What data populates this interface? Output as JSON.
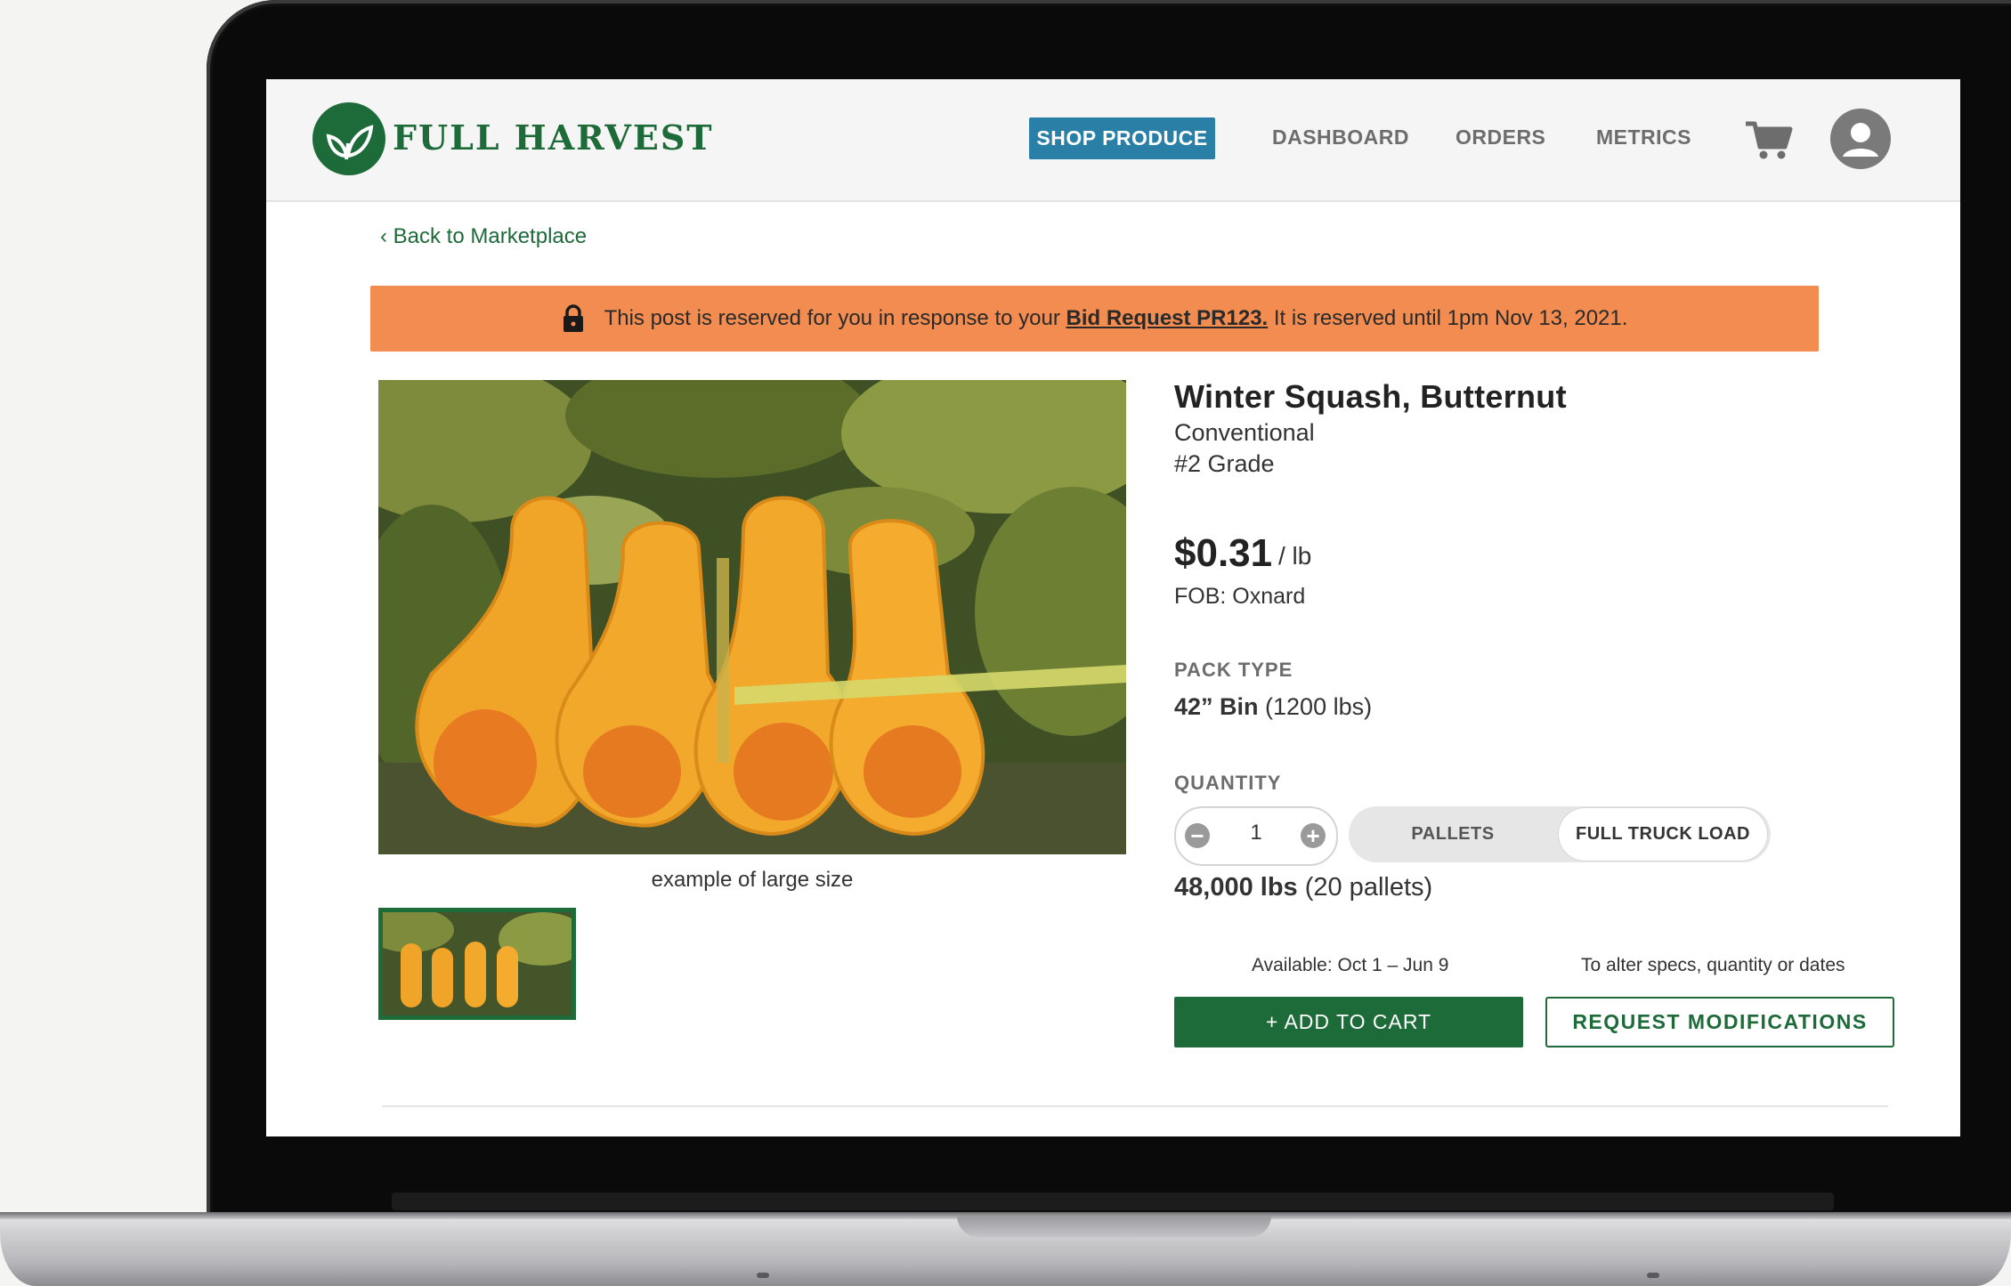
{
  "brand": {
    "name": "FULL HARVEST",
    "color": "#1e6b3a"
  },
  "nav": {
    "items": [
      "SHOP PRODUCE",
      "DASHBOARD",
      "ORDERS",
      "METRICS"
    ],
    "active": "SHOP PRODUCE",
    "icons": [
      "cart-icon",
      "avatar-icon"
    ]
  },
  "back_link": "‹ Back to Marketplace",
  "banner": {
    "text_before": "This post is reserved for you in response to your ",
    "link_text": "Bid Request PR123.",
    "text_after": " It is reserved until 1pm Nov 13, 2021.",
    "icon": "lock-icon",
    "color": "#f28c50"
  },
  "product": {
    "title": "Winter Squash, Butternut",
    "type": "Conventional",
    "grade": "#2 Grade",
    "price": "$0.31",
    "price_unit": "/ lb",
    "fob": "FOB: Oxnard",
    "image_caption": "example of large size",
    "pack_type_label": "PACK TYPE",
    "pack_type_bold": "42” Bin",
    "pack_type_weight": " (1200 lbs)",
    "quantity_label": "QUANTITY",
    "quantity_value": "1",
    "unit_options": [
      "PALLETS",
      "FULL TRUCK LOAD"
    ],
    "unit_selected": "FULL TRUCK LOAD",
    "total_weight_bold": "48,000 lbs",
    "total_weight_note": " (20 pallets)",
    "availability": "Available: Oct 1 – Jun 9",
    "modify_hint": "To alter specs, quantity or dates"
  },
  "actions": {
    "add_to_cart": "+ ADD TO CART",
    "request_modifications": "REQUEST MODIFICATIONS"
  }
}
